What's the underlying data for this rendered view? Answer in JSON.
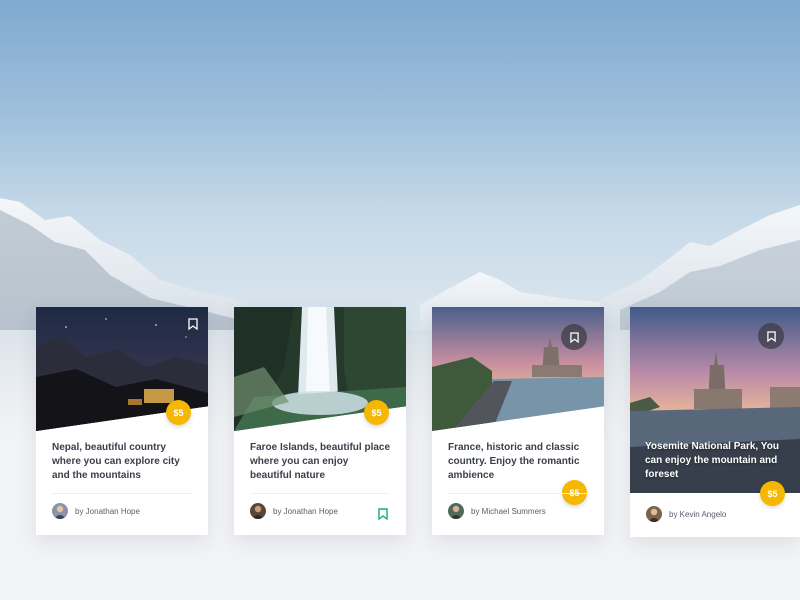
{
  "colors": {
    "price_badge": "#f5b700",
    "bookmark_saved": "#1bab7a",
    "text_dark": "#3a3f4a"
  },
  "cards": [
    {
      "description": "Nepal, beautiful country where you can explore city and the mountains",
      "author": "by Jonathan Hope",
      "price": "$5",
      "bookmark_icon": "bookmark-outline-icon"
    },
    {
      "description": "Faroe Islands, beautiful place where you can enjoy beautiful nature",
      "author": "by Jonathan Hope",
      "price": "$5",
      "bookmark_icon": "bookmark-saved-icon"
    },
    {
      "description": "France, historic and classic country. Enjoy the romantic ambience",
      "author": "by Michael Summers",
      "price": "$5",
      "bookmark_icon": "bookmark-icon"
    },
    {
      "description": "Yosemite National Park, You can enjoy the mountain and foreset",
      "author": "by Kevin Angelo",
      "price": "$5",
      "bookmark_icon": "bookmark-icon"
    }
  ]
}
